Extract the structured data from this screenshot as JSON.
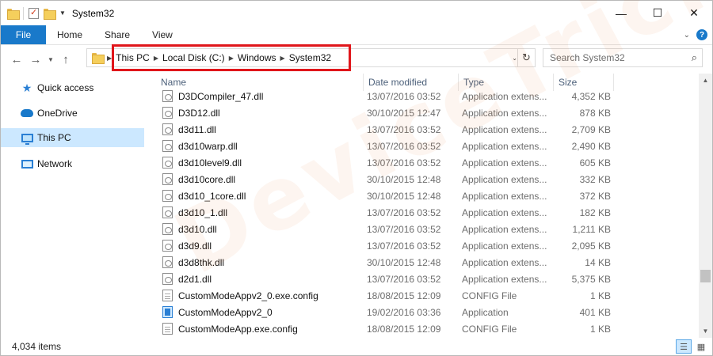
{
  "window": {
    "title": "System32",
    "controls": {
      "minimize": "—",
      "maximize": "☐",
      "close": "✕"
    }
  },
  "ribbon": {
    "tabs": [
      {
        "label": "File",
        "active": true
      },
      {
        "label": "Home"
      },
      {
        "label": "Share"
      },
      {
        "label": "View"
      }
    ]
  },
  "navigation": {
    "back_icon": "arrow-left-icon",
    "forward_icon": "arrow-right-icon",
    "up_icon": "arrow-up-icon",
    "breadcrumbs": [
      "This PC",
      "Local Disk (C:)",
      "Windows",
      "System32"
    ],
    "search_placeholder": "Search System32"
  },
  "sidebar": {
    "items": [
      {
        "label": "Quick access",
        "icon": "star-icon"
      },
      {
        "label": "OneDrive",
        "icon": "cloud-icon"
      },
      {
        "label": "This PC",
        "icon": "computer-icon",
        "selected": true
      },
      {
        "label": "Network",
        "icon": "network-icon"
      }
    ]
  },
  "columns": {
    "name": "Name",
    "date": "Date modified",
    "type": "Type",
    "size": "Size"
  },
  "files": [
    {
      "name": "D3DCompiler_47.dll",
      "date": "13/07/2016 03:52",
      "type": "Application extens...",
      "size": "4,352 KB",
      "icon": "dll"
    },
    {
      "name": "D3D12.dll",
      "date": "30/10/2015 12:47",
      "type": "Application extens...",
      "size": "878 KB",
      "icon": "dll"
    },
    {
      "name": "d3d11.dll",
      "date": "13/07/2016 03:52",
      "type": "Application extens...",
      "size": "2,709 KB",
      "icon": "dll"
    },
    {
      "name": "d3d10warp.dll",
      "date": "13/07/2016 03:52",
      "type": "Application extens...",
      "size": "2,490 KB",
      "icon": "dll"
    },
    {
      "name": "d3d10level9.dll",
      "date": "13/07/2016 03:52",
      "type": "Application extens...",
      "size": "605 KB",
      "icon": "dll"
    },
    {
      "name": "d3d10core.dll",
      "date": "30/10/2015 12:48",
      "type": "Application extens...",
      "size": "332 KB",
      "icon": "dll"
    },
    {
      "name": "d3d10_1core.dll",
      "date": "30/10/2015 12:48",
      "type": "Application extens...",
      "size": "372 KB",
      "icon": "dll"
    },
    {
      "name": "d3d10_1.dll",
      "date": "13/07/2016 03:52",
      "type": "Application extens...",
      "size": "182 KB",
      "icon": "dll"
    },
    {
      "name": "d3d10.dll",
      "date": "13/07/2016 03:52",
      "type": "Application extens...",
      "size": "1,211 KB",
      "icon": "dll"
    },
    {
      "name": "d3d9.dll",
      "date": "13/07/2016 03:52",
      "type": "Application extens...",
      "size": "2,095 KB",
      "icon": "dll"
    },
    {
      "name": "d3d8thk.dll",
      "date": "30/10/2015 12:48",
      "type": "Application extens...",
      "size": "14 KB",
      "icon": "dll"
    },
    {
      "name": "d2d1.dll",
      "date": "13/07/2016 03:52",
      "type": "Application extens...",
      "size": "5,375 KB",
      "icon": "dll"
    },
    {
      "name": "CustomModeAppv2_0.exe.config",
      "date": "18/08/2015 12:09",
      "type": "CONFIG File",
      "size": "1 KB",
      "icon": "cfg"
    },
    {
      "name": "CustomModeAppv2_0",
      "date": "19/02/2016 03:36",
      "type": "Application",
      "size": "401 KB",
      "icon": "app"
    },
    {
      "name": "CustomModeApp.exe.config",
      "date": "18/08/2015 12:09",
      "type": "CONFIG File",
      "size": "1 KB",
      "icon": "cfg"
    }
  ],
  "status": {
    "item_count": "4,034 items"
  },
  "watermark": {
    "text": "DeviceTricks"
  },
  "colors": {
    "accent": "#1979ca",
    "selection": "#cce8ff",
    "highlight_box": "#e0161b",
    "secondary_text": "#6d6d6d"
  }
}
